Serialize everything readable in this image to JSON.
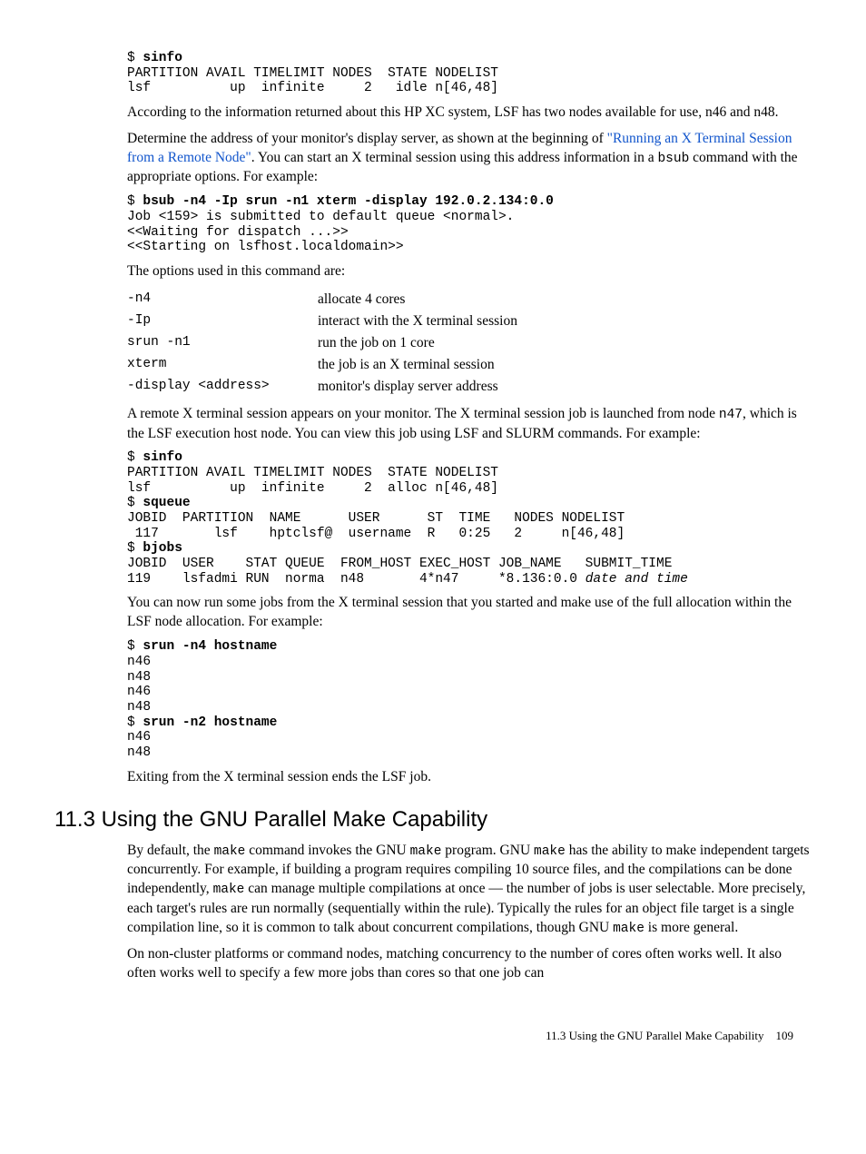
{
  "block1": {
    "line1_prefix": "$ ",
    "line1_cmd": "sinfo",
    "line2": "PARTITION AVAIL TIMELIMIT NODES  STATE NODELIST",
    "line3": "lsf          up  infinite     2   idle n[46,48]"
  },
  "para1": "According to the information returned about this HP XC system, LSF has two nodes available for use, n46 and n48.",
  "para2_a": "Determine the address of your monitor's display server, as shown at the beginning of ",
  "para2_link": "\"Running an X Terminal Session from a Remote Node\"",
  "para2_b": ". You can start an X terminal session using this address information in a ",
  "para2_code": "bsub",
  "para2_c": " command with the appropriate options. For example:",
  "block2": {
    "line1_prefix": "$ ",
    "line1_cmd": "bsub -n4 -Ip srun -n1 xterm -display 192.0.2.134:0.0",
    "line2": "Job <159> is submitted to default queue <normal>.",
    "line3": "<<Waiting for dispatch ...>>",
    "line4": "<<Starting on lsfhost.localdomain>>"
  },
  "para3": "The options used in this command are:",
  "opts": {
    "r1c1": "-n4",
    "r1c2": "allocate 4 cores",
    "r2c1": "-Ip",
    "r2c2": "interact with the X terminal session",
    "r3c1": "srun -n1",
    "r3c2": "run the job on 1 core",
    "r4c1": "xterm",
    "r4c2": "the job is an X terminal session",
    "r5c1": "-display <address>",
    "r5c2": "monitor's display server address"
  },
  "para4_a": "A remote X terminal session appears on your monitor. The X terminal session job is launched from node ",
  "para4_code": "n47",
  "para4_b": ", which is the LSF execution host node. You can view this job using LSF and SLURM commands. For example:",
  "block3": {
    "l1p": "$ ",
    "l1c": "sinfo",
    "l2": "PARTITION AVAIL TIMELIMIT NODES  STATE NODELIST",
    "l3": "lsf          up  infinite     2  alloc n[46,48]",
    "l4p": "$ ",
    "l4c": "squeue",
    "l5": "JOBID  PARTITION  NAME      USER      ST  TIME   NODES NODELIST",
    "l6": " 117       lsf    hptclsf@  username  R   0:25   2     n[46,48]",
    "l7p": "$ ",
    "l7c": "bjobs",
    "l8": "JOBID  USER    STAT QUEUE  FROM_HOST EXEC_HOST JOB_NAME   SUBMIT_TIME",
    "l9a": "119    lsfadmi RUN  norma  n48       4*n47     *8.136:0.0 ",
    "l9b": "date and time"
  },
  "para5": "You can now run some jobs from the X terminal session that you started and make use of the full allocation within the LSF node allocation. For example:",
  "block4": {
    "l1p": "$ ",
    "l1c": "srun -n4 hostname",
    "l2": "n46",
    "l3": "n48",
    "l4": "n46",
    "l5": "n48",
    "l6p": "$ ",
    "l6c": "srun -n2 hostname",
    "l7": "n46",
    "l8": "n48"
  },
  "para6": "Exiting from the X terminal session ends the LSF job.",
  "heading": "11.3 Using the GNU Parallel Make Capability",
  "para7_a": "By default, the ",
  "para7_c1": "make",
  "para7_b": " command invokes the GNU ",
  "para7_c2": "make",
  "para7_c": " program. GNU ",
  "para7_c3": "make",
  "para7_d": " has the ability to make independent targets concurrently. For example, if building a program requires compiling 10 source files, and the compilations can be done independently, ",
  "para7_c4": "make",
  "para7_e": " can manage multiple compilations at once — the number of jobs is user selectable. More precisely, each target's rules are run normally (sequentially within the rule). Typically the rules for an object file target is a single compilation line, so it is common to talk about concurrent compilations, though GNU ",
  "para7_c5": "make",
  "para7_f": " is more general.",
  "para8": "On non-cluster platforms or command nodes, matching concurrency to the number of cores often works well. It also often works well to specify a few more jobs than cores so that one job can",
  "footer_a": "11.3 Using the GNU Parallel Make Capability",
  "footer_b": "109"
}
